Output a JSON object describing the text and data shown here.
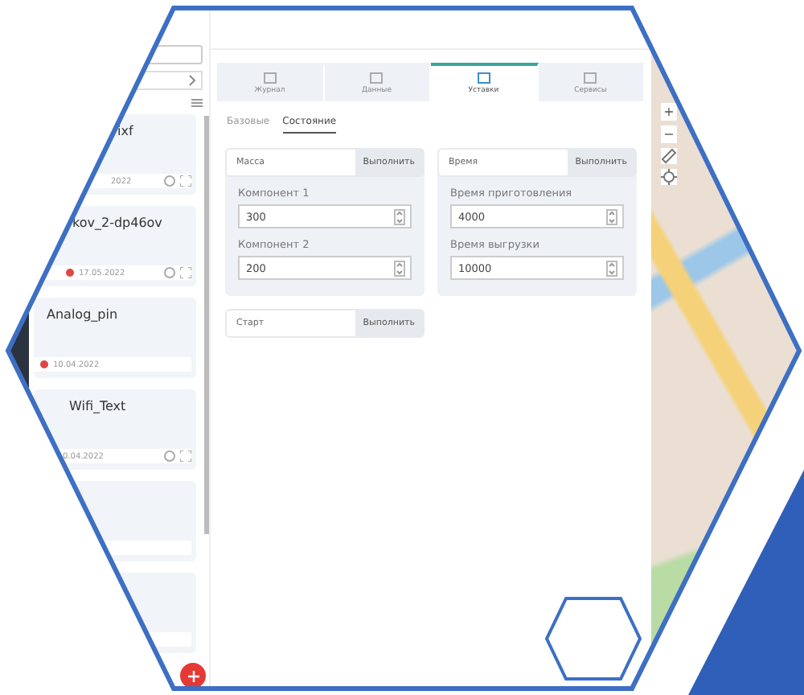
{
  "sidebar": {
    "cards": [
      {
        "title": "ixf",
        "date": "2022",
        "status_dot": false,
        "actions": true
      },
      {
        "title": "kov_2-dp46ov",
        "date": "17.05.2022",
        "status_dot": true,
        "actions": true
      },
      {
        "title": "Analog_pin",
        "date": "10.04.2022",
        "status_dot": true,
        "actions": false
      },
      {
        "title": "Wifi_Text",
        "date": "0.04.2022",
        "status_dot": false,
        "actions": true
      },
      {
        "actions": false
      },
      {
        "actions": false
      }
    ]
  },
  "tabs": [
    {
      "label": "Журнал",
      "selected": false
    },
    {
      "label": "Данные",
      "selected": false
    },
    {
      "label": "Уставки",
      "selected": true
    },
    {
      "label": "Сервисы",
      "selected": false
    }
  ],
  "subtabs": [
    {
      "label": "Базовые",
      "selected": false
    },
    {
      "label": "Состояние",
      "selected": true
    }
  ],
  "groups": [
    {
      "title": "Масса",
      "button": "Выполнить",
      "fields": [
        {
          "label": "Компонент 1",
          "value": "300"
        },
        {
          "label": "Компонент 2",
          "value": "200"
        }
      ]
    },
    {
      "title": "Время",
      "button": "Выполнить",
      "fields": [
        {
          "label": "Время приготовления",
          "value": "4000"
        },
        {
          "label": "Время выгрузки",
          "value": "10000"
        }
      ]
    },
    {
      "title": "Старт",
      "button": "Выполнить"
    }
  ],
  "map": {
    "zoom_in": "+",
    "zoom_out": "−"
  }
}
